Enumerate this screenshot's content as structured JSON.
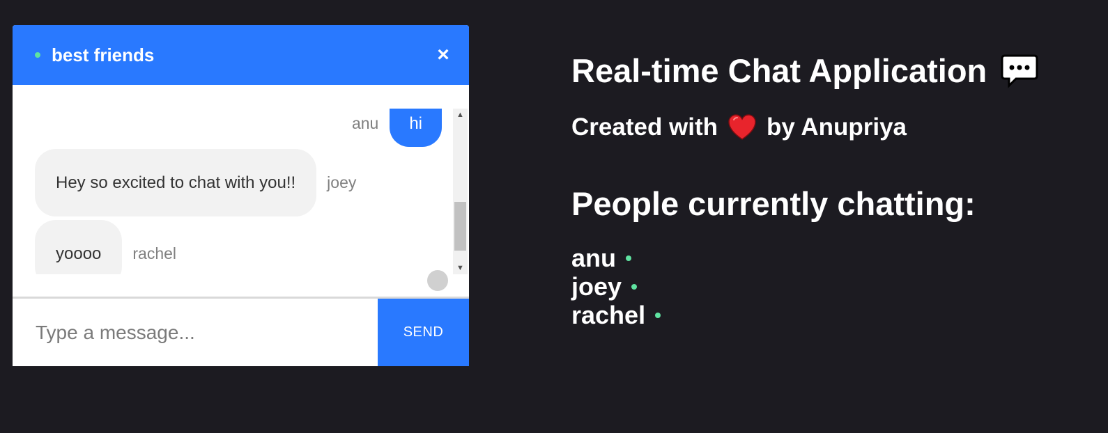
{
  "chat": {
    "room_name": "best friends",
    "close_label": "×",
    "messages": [
      {
        "user": "anu",
        "text": "hi",
        "self": true
      },
      {
        "user": "joey",
        "text": "Hey so excited to chat with you!!",
        "self": false
      },
      {
        "user": "rachel",
        "text": "yoooo",
        "self": false
      }
    ],
    "composer": {
      "placeholder": "Type a message...",
      "value": "",
      "send_label": "SEND"
    }
  },
  "info": {
    "title": "Real-time Chat Application",
    "title_icon": "speech-bubble-icon",
    "credits_prefix": "Created with",
    "credits_icon": "heart-icon",
    "credits_suffix": "by Anupriya",
    "people_heading": "People currently chatting:",
    "people": [
      "anu",
      "joey",
      "rachel"
    ]
  },
  "colors": {
    "background": "#1c1b21",
    "accent": "#2979ff",
    "online": "#5fe3a1",
    "bubble_other": "#f2f2f2",
    "heart": "#e8242c"
  }
}
